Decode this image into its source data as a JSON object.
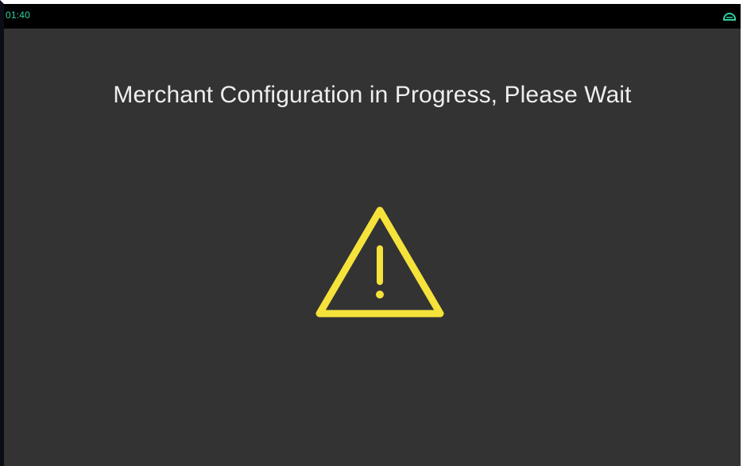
{
  "status_bar": {
    "time": "01:40",
    "connection_icon": "connection-indicator-icon",
    "accent_color": "#2fd0a3"
  },
  "main": {
    "title": "Merchant Configuration in Progress, Please Wait",
    "warning_icon": "warning-triangle-icon",
    "warning_color": "#f5e23a",
    "background_color": "#333333"
  }
}
